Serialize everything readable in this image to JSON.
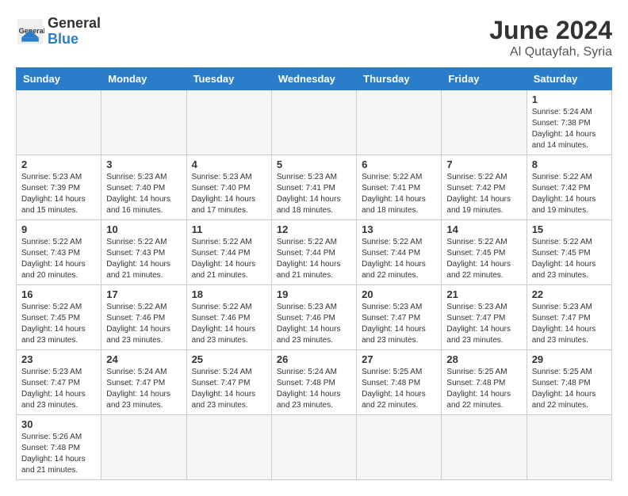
{
  "logo": {
    "text_general": "General",
    "text_blue": "Blue"
  },
  "header": {
    "month_year": "June 2024",
    "location": "Al Qutayfah, Syria"
  },
  "weekdays": [
    "Sunday",
    "Monday",
    "Tuesday",
    "Wednesday",
    "Thursday",
    "Friday",
    "Saturday"
  ],
  "days": [
    {
      "num": "",
      "info": "",
      "empty": true
    },
    {
      "num": "",
      "info": "",
      "empty": true
    },
    {
      "num": "",
      "info": "",
      "empty": true
    },
    {
      "num": "",
      "info": "",
      "empty": true
    },
    {
      "num": "",
      "info": "",
      "empty": true
    },
    {
      "num": "",
      "info": "",
      "empty": true
    },
    {
      "num": "1",
      "info": "Sunrise: 5:24 AM\nSunset: 7:38 PM\nDaylight: 14 hours\nand 14 minutes.",
      "empty": false
    },
    {
      "num": "2",
      "info": "Sunrise: 5:23 AM\nSunset: 7:39 PM\nDaylight: 14 hours\nand 15 minutes.",
      "empty": false
    },
    {
      "num": "3",
      "info": "Sunrise: 5:23 AM\nSunset: 7:40 PM\nDaylight: 14 hours\nand 16 minutes.",
      "empty": false
    },
    {
      "num": "4",
      "info": "Sunrise: 5:23 AM\nSunset: 7:40 PM\nDaylight: 14 hours\nand 17 minutes.",
      "empty": false
    },
    {
      "num": "5",
      "info": "Sunrise: 5:23 AM\nSunset: 7:41 PM\nDaylight: 14 hours\nand 18 minutes.",
      "empty": false
    },
    {
      "num": "6",
      "info": "Sunrise: 5:22 AM\nSunset: 7:41 PM\nDaylight: 14 hours\nand 18 minutes.",
      "empty": false
    },
    {
      "num": "7",
      "info": "Sunrise: 5:22 AM\nSunset: 7:42 PM\nDaylight: 14 hours\nand 19 minutes.",
      "empty": false
    },
    {
      "num": "8",
      "info": "Sunrise: 5:22 AM\nSunset: 7:42 PM\nDaylight: 14 hours\nand 19 minutes.",
      "empty": false
    },
    {
      "num": "9",
      "info": "Sunrise: 5:22 AM\nSunset: 7:43 PM\nDaylight: 14 hours\nand 20 minutes.",
      "empty": false
    },
    {
      "num": "10",
      "info": "Sunrise: 5:22 AM\nSunset: 7:43 PM\nDaylight: 14 hours\nand 21 minutes.",
      "empty": false
    },
    {
      "num": "11",
      "info": "Sunrise: 5:22 AM\nSunset: 7:44 PM\nDaylight: 14 hours\nand 21 minutes.",
      "empty": false
    },
    {
      "num": "12",
      "info": "Sunrise: 5:22 AM\nSunset: 7:44 PM\nDaylight: 14 hours\nand 21 minutes.",
      "empty": false
    },
    {
      "num": "13",
      "info": "Sunrise: 5:22 AM\nSunset: 7:44 PM\nDaylight: 14 hours\nand 22 minutes.",
      "empty": false
    },
    {
      "num": "14",
      "info": "Sunrise: 5:22 AM\nSunset: 7:45 PM\nDaylight: 14 hours\nand 22 minutes.",
      "empty": false
    },
    {
      "num": "15",
      "info": "Sunrise: 5:22 AM\nSunset: 7:45 PM\nDaylight: 14 hours\nand 23 minutes.",
      "empty": false
    },
    {
      "num": "16",
      "info": "Sunrise: 5:22 AM\nSunset: 7:45 PM\nDaylight: 14 hours\nand 23 minutes.",
      "empty": false
    },
    {
      "num": "17",
      "info": "Sunrise: 5:22 AM\nSunset: 7:46 PM\nDaylight: 14 hours\nand 23 minutes.",
      "empty": false
    },
    {
      "num": "18",
      "info": "Sunrise: 5:22 AM\nSunset: 7:46 PM\nDaylight: 14 hours\nand 23 minutes.",
      "empty": false
    },
    {
      "num": "19",
      "info": "Sunrise: 5:23 AM\nSunset: 7:46 PM\nDaylight: 14 hours\nand 23 minutes.",
      "empty": false
    },
    {
      "num": "20",
      "info": "Sunrise: 5:23 AM\nSunset: 7:47 PM\nDaylight: 14 hours\nand 23 minutes.",
      "empty": false
    },
    {
      "num": "21",
      "info": "Sunrise: 5:23 AM\nSunset: 7:47 PM\nDaylight: 14 hours\nand 23 minutes.",
      "empty": false
    },
    {
      "num": "22",
      "info": "Sunrise: 5:23 AM\nSunset: 7:47 PM\nDaylight: 14 hours\nand 23 minutes.",
      "empty": false
    },
    {
      "num": "23",
      "info": "Sunrise: 5:23 AM\nSunset: 7:47 PM\nDaylight: 14 hours\nand 23 minutes.",
      "empty": false
    },
    {
      "num": "24",
      "info": "Sunrise: 5:24 AM\nSunset: 7:47 PM\nDaylight: 14 hours\nand 23 minutes.",
      "empty": false
    },
    {
      "num": "25",
      "info": "Sunrise: 5:24 AM\nSunset: 7:47 PM\nDaylight: 14 hours\nand 23 minutes.",
      "empty": false
    },
    {
      "num": "26",
      "info": "Sunrise: 5:24 AM\nSunset: 7:48 PM\nDaylight: 14 hours\nand 23 minutes.",
      "empty": false
    },
    {
      "num": "27",
      "info": "Sunrise: 5:25 AM\nSunset: 7:48 PM\nDaylight: 14 hours\nand 22 minutes.",
      "empty": false
    },
    {
      "num": "28",
      "info": "Sunrise: 5:25 AM\nSunset: 7:48 PM\nDaylight: 14 hours\nand 22 minutes.",
      "empty": false
    },
    {
      "num": "29",
      "info": "Sunrise: 5:25 AM\nSunset: 7:48 PM\nDaylight: 14 hours\nand 22 minutes.",
      "empty": false
    },
    {
      "num": "30",
      "info": "Sunrise: 5:26 AM\nSunset: 7:48 PM\nDaylight: 14 hours\nand 21 minutes.",
      "empty": false
    },
    {
      "num": "",
      "info": "",
      "empty": true
    },
    {
      "num": "",
      "info": "",
      "empty": true
    },
    {
      "num": "",
      "info": "",
      "empty": true
    },
    {
      "num": "",
      "info": "",
      "empty": true
    },
    {
      "num": "",
      "info": "",
      "empty": true
    },
    {
      "num": "",
      "info": "",
      "empty": true
    }
  ]
}
